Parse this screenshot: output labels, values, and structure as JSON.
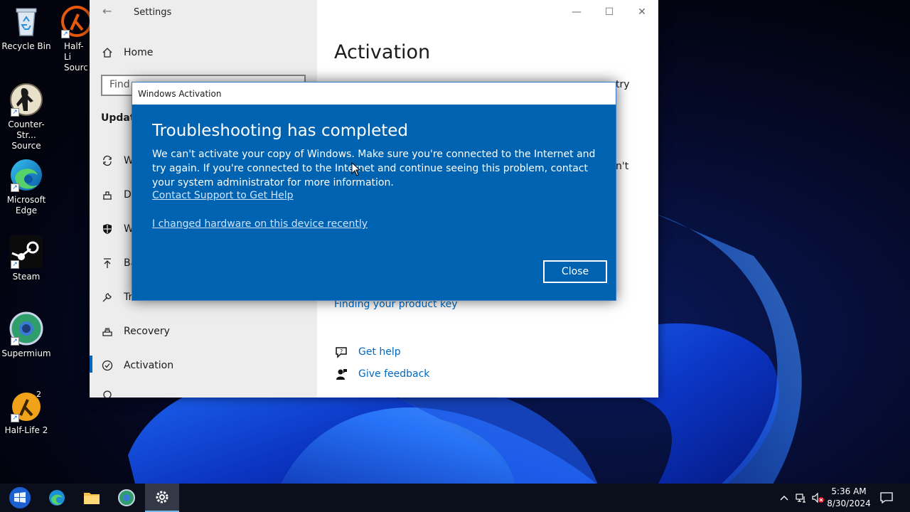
{
  "desktop": {
    "icons": [
      {
        "label": "Recycle Bin"
      },
      {
        "label": "Half-Life Source",
        "visible_label": "Half-Li\nSourc"
      },
      {
        "label": "Counter-Str...\nSource"
      },
      {
        "label": "Microsoft\nEdge"
      },
      {
        "label": "Steam"
      },
      {
        "label": "Supermium"
      },
      {
        "label": "Half-Life 2"
      }
    ]
  },
  "settings": {
    "window_title": "Settings",
    "sidebar": {
      "home": "Home",
      "find_placeholder": "Find",
      "section_header": "Update",
      "items": [
        {
          "label": "W",
          "icon": "sync-icon"
        },
        {
          "label": "De",
          "icon": "delivery-icon"
        },
        {
          "label": "W",
          "icon": "shield-icon"
        },
        {
          "label": "Ba",
          "icon": "backup-arrow-icon"
        },
        {
          "label": "Troubleshoot",
          "icon": "wrench-icon"
        },
        {
          "label": "Recovery",
          "icon": "recovery-icon"
        },
        {
          "label": "Activation",
          "icon": "check-circle-icon"
        }
      ]
    },
    "main": {
      "title": "Activation",
      "peek_text_1": "try",
      "peek_text_2": "n't",
      "finding_key_link": "Finding your product key",
      "get_help": "Get help",
      "give_feedback": "Give feedback"
    }
  },
  "dialog": {
    "title": "Windows Activation",
    "heading": "Troubleshooting has completed",
    "body": "We can't activate your copy of Windows. Make sure you're connected to the Internet and try again. If you're connected to the Internet and continue seeing this problem, contact your system administrator for more information.",
    "link_support": "Contact Support to Get Help",
    "link_hardware": "I changed hardware on this device recently",
    "close_label": "Close"
  },
  "taskbar": {
    "time": "5:36 AM",
    "date": "8/30/2024"
  },
  "colors": {
    "dialog_blue": "#0063b1",
    "accent": "#0067c0"
  }
}
